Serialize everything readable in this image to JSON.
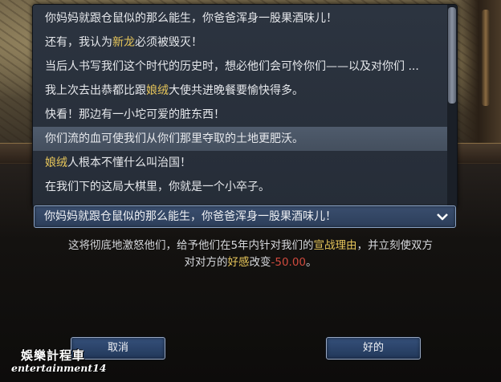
{
  "list": {
    "items": [
      {
        "parts": [
          {
            "t": "你妈妈就跟仓鼠似的那么能生，你爸爸浑身一股果酒味儿！"
          }
        ]
      },
      {
        "parts": [
          {
            "t": "还有，我认为"
          },
          {
            "t": "新龙",
            "hl": true
          },
          {
            "t": "必须被毁灭！"
          }
        ]
      },
      {
        "parts": [
          {
            "t": "当后人书写我们这个时代的历史时，想必他们会可怜你们——以及对你们 ..."
          }
        ]
      },
      {
        "parts": [
          {
            "t": "我上次去出恭都比跟"
          },
          {
            "t": "娘绒",
            "hl": true
          },
          {
            "t": "大使共进晚餐要愉快得多。"
          }
        ]
      },
      {
        "parts": [
          {
            "t": "快看！那边有一小坨可爱的脏东西！"
          }
        ]
      },
      {
        "parts": [
          {
            "t": "你们流的血可使我们从你们那里夺取的土地更肥沃。"
          }
        ],
        "selected": true
      },
      {
        "parts": [
          {
            "t": "娘绒",
            "hl": true
          },
          {
            "t": "人根本不懂什么叫治国！"
          }
        ]
      },
      {
        "parts": [
          {
            "t": "在我们下的这局大棋里，你就是一个小卒子。"
          }
        ]
      }
    ]
  },
  "combo": {
    "value": "你妈妈就跟仓鼠似的那么能生，你爸爸浑身一股果酒味儿！"
  },
  "description": {
    "line1_a": "这将彻底地激怒他们，给予他们在5年内针对我们的",
    "line1_b": "宣战理由",
    "line1_c": "，并立刻使双方",
    "line2_a": "对对方的",
    "line2_b": "好感",
    "line2_c": "改变",
    "line2_d": "-50.00",
    "line2_e": "。"
  },
  "buttons": {
    "cancel": "取消",
    "ok": "好的"
  },
  "watermark": {
    "line1": "娛樂計程車",
    "line2": "entertainment14"
  },
  "colors": {
    "highlight": "#e6c55a",
    "negative": "#d04a3e",
    "list_bg": "#2c3440",
    "button_bg": "#2c4468"
  }
}
